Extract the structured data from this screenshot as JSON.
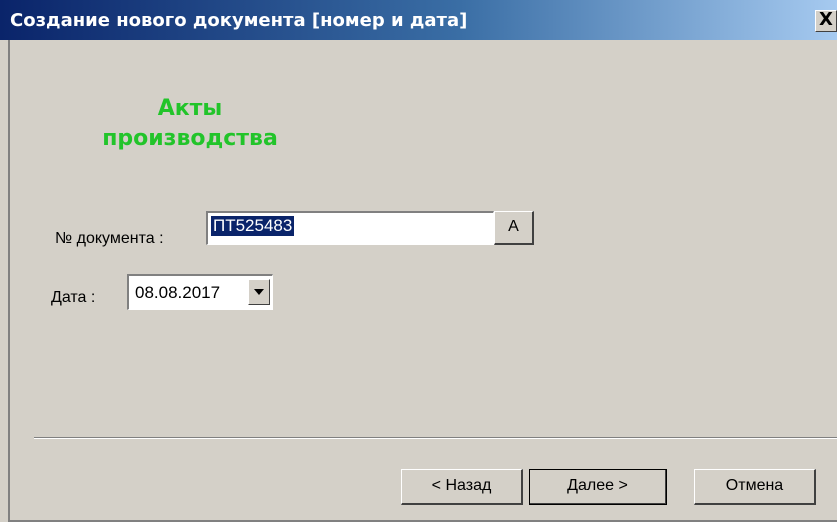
{
  "window": {
    "title": "Создание нового документа [номер и дата]",
    "close_label": "X"
  },
  "heading": {
    "line1": "Акты",
    "line2": "производства",
    "color": "#22c42a"
  },
  "form": {
    "doc_number_label": "№ документа :",
    "doc_number_value": "ПТ525483",
    "auto_button_label": "А",
    "date_label": "Дата :",
    "date_value": "08.08.2017"
  },
  "buttons": {
    "back": "< Назад",
    "next": "Далее >",
    "cancel": "Отмена"
  }
}
